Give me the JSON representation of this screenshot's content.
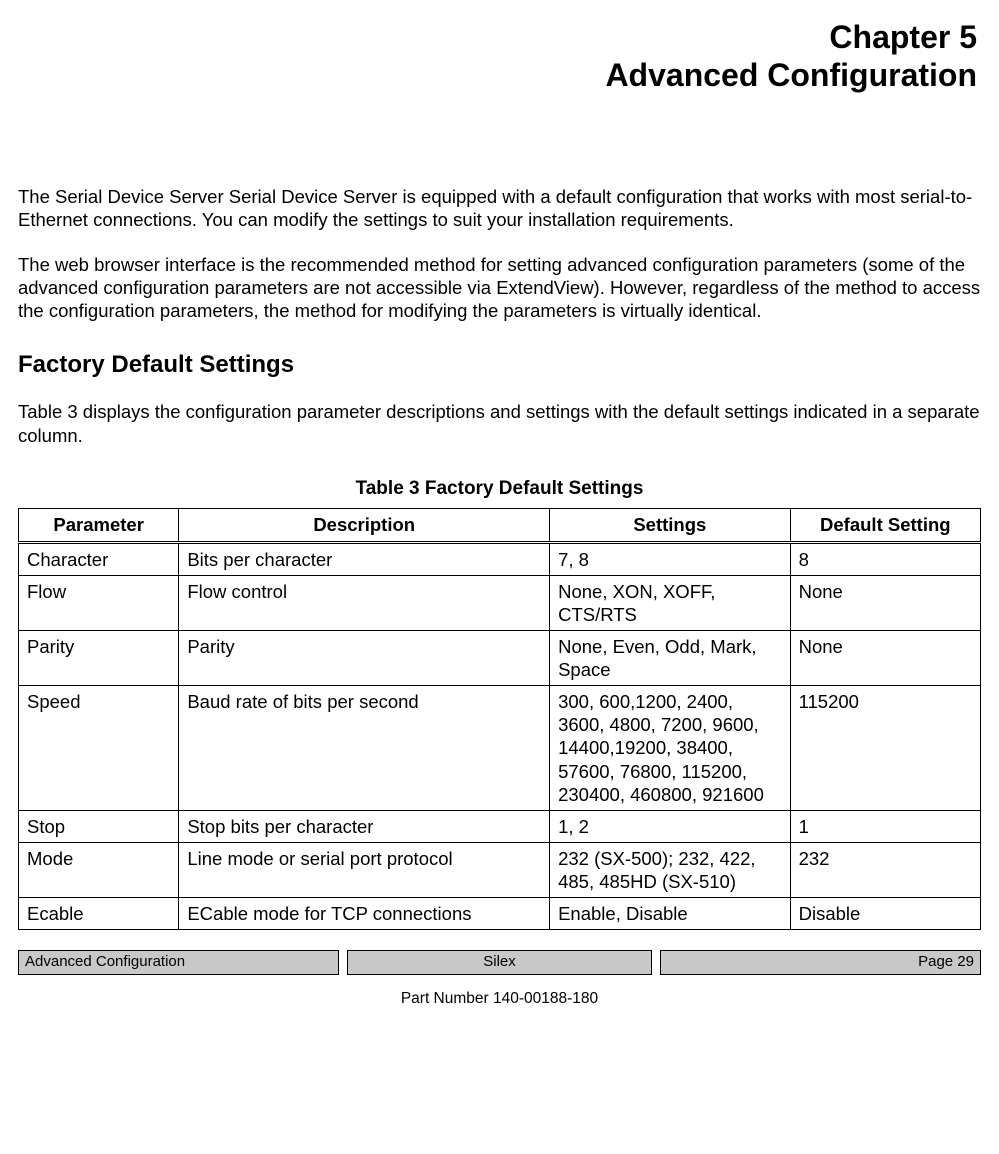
{
  "header": {
    "chapter_line": "Chapter 5",
    "title_line": "Advanced Configuration"
  },
  "intro": {
    "p1": "The Serial Device Server Serial Device Server is equipped with a default configuration that works with most serial-to-Ethernet connections. You can modify the settings to suit your installation requirements.",
    "p2": "The web browser interface is the recommended method for setting advanced configuration parameters (some of the advanced configuration parameters are not accessible via ExtendView). However, regardless of the method to access the configuration parameters, the method for modifying the parameters is virtually identical."
  },
  "section": {
    "heading": "Factory Default Settings",
    "lead": "Table 3 displays the configuration parameter descriptions and settings with the default settings indicated in a separate column."
  },
  "table": {
    "caption": "Table 3  Factory Default Settings",
    "headers": {
      "param": "Parameter",
      "desc": "Description",
      "settings": "Settings",
      "default": "Default Setting"
    },
    "rows": [
      {
        "param": "Character",
        "desc": "Bits per character",
        "settings": "7, 8",
        "default": "8"
      },
      {
        "param": "Flow",
        "desc": "Flow control",
        "settings": "None, XON, XOFF, CTS/RTS",
        "default": "None"
      },
      {
        "param": "Parity",
        "desc": "Parity",
        "settings": "None, Even, Odd, Mark, Space",
        "default": "None"
      },
      {
        "param": "Speed",
        "desc": "Baud rate of bits per second",
        "settings": "300, 600,1200, 2400, 3600, 4800, 7200, 9600, 14400,19200, 38400, 57600, 76800, 115200, 230400, 460800, 921600",
        "default": "115200"
      },
      {
        "param": "Stop",
        "desc": "Stop bits per character",
        "settings": "1, 2",
        "default": "1"
      },
      {
        "param": "Mode",
        "desc": "Line mode or serial port protocol",
        "settings": "232 (SX-500); 232, 422, 485, 485HD (SX-510)",
        "default": "232"
      },
      {
        "param": "Ecable",
        "desc": "ECable mode for TCP connections",
        "settings": "Enable, Disable",
        "default": "Disable"
      }
    ]
  },
  "footer": {
    "left": "Advanced Configuration",
    "center": "Silex",
    "right": "Page 29",
    "part": "Part Number 140-00188-180"
  }
}
